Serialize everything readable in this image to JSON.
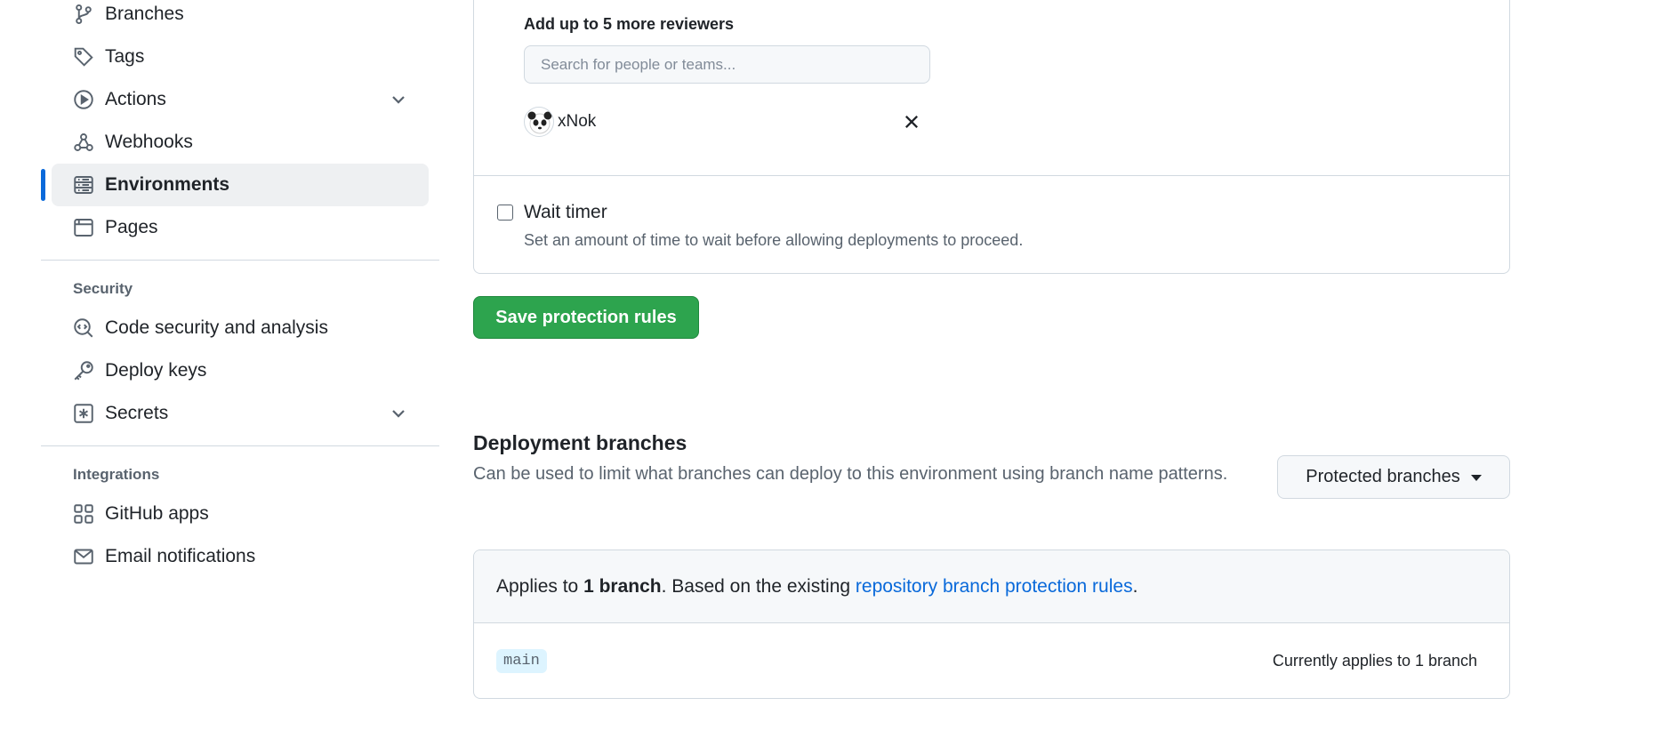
{
  "sidebar": {
    "items_top": [
      {
        "label": "Branches",
        "icon": "git-branch-icon"
      },
      {
        "label": "Tags",
        "icon": "tag-icon"
      },
      {
        "label": "Actions",
        "icon": "play-icon",
        "expandable": true
      },
      {
        "label": "Webhooks",
        "icon": "webhook-icon"
      },
      {
        "label": "Environments",
        "icon": "server-icon",
        "active": true
      },
      {
        "label": "Pages",
        "icon": "browser-icon"
      }
    ],
    "security_heading": "Security",
    "security_items": [
      {
        "label": "Code security and analysis",
        "icon": "codescan-icon"
      },
      {
        "label": "Deploy keys",
        "icon": "key-icon"
      },
      {
        "label": "Secrets",
        "icon": "key-asterisk-icon",
        "expandable": true
      }
    ],
    "integrations_heading": "Integrations",
    "integrations_items": [
      {
        "label": "GitHub apps",
        "icon": "apps-icon"
      },
      {
        "label": "Email notifications",
        "icon": "mail-icon"
      }
    ]
  },
  "reviewers": {
    "label": "Add up to 5 more reviewers",
    "search_placeholder": "Search for people or teams...",
    "reviewer_name": "xNok"
  },
  "wait_timer": {
    "title": "Wait timer",
    "description": "Set an amount of time to wait before allowing deployments to proceed."
  },
  "save_button": "Save protection rules",
  "deployment_branches": {
    "title": "Deployment branches",
    "description": "Can be used to limit what branches can deploy to this environment using branch name patterns.",
    "dropdown_label": "Protected branches",
    "applies_prefix": "Applies to ",
    "applies_count": "1 branch",
    "applies_middle": ". Based on the existing ",
    "applies_link": "repository branch protection rules",
    "applies_suffix": ".",
    "branch_name": "main",
    "branch_status": "Currently applies to 1 branch"
  },
  "colors": {
    "accent": "#0969da",
    "save_green": "#2da44e",
    "muted_text": "#59636e",
    "border": "#d1d9e0"
  }
}
